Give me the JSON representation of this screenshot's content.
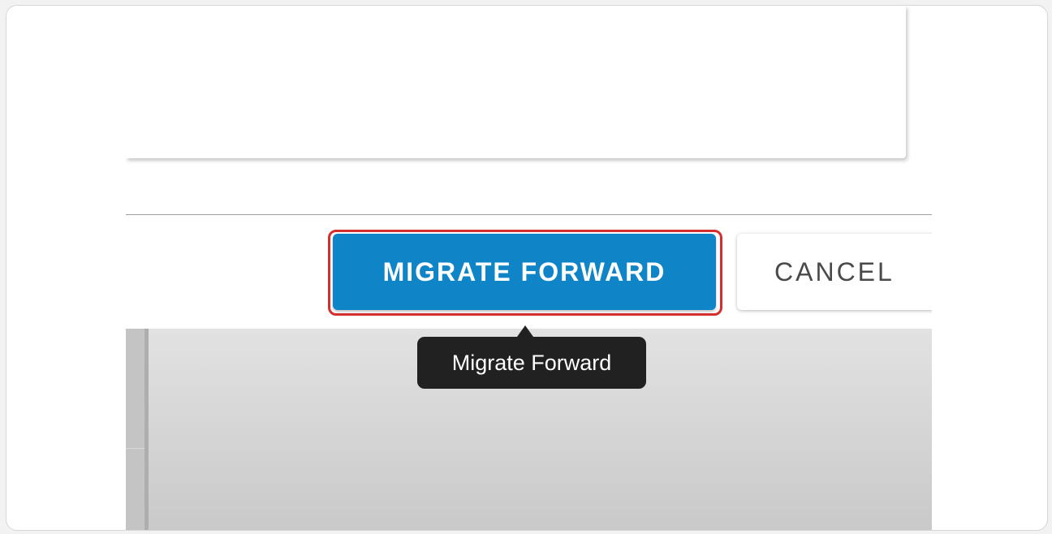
{
  "actions": {
    "migrate_forward_label": "MIGRATE FORWARD",
    "cancel_label": "CANCEL"
  },
  "tooltip": {
    "text": "Migrate Forward"
  },
  "colors": {
    "primary": "#0f85c8",
    "highlight": "#d32f2f",
    "tooltip_bg": "#212121"
  }
}
